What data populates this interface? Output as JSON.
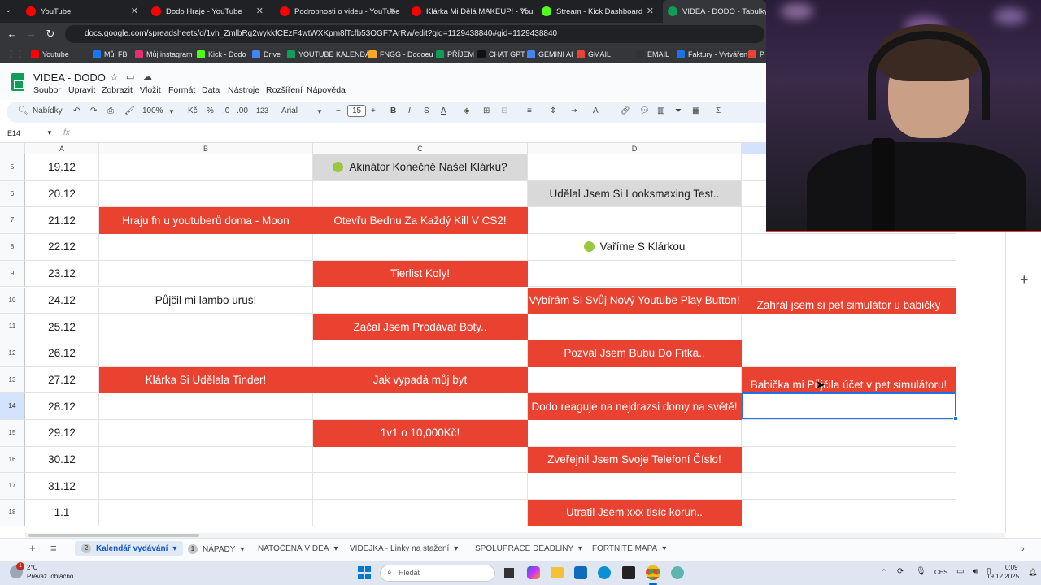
{
  "browser": {
    "tabs": [
      {
        "title": "YouTube",
        "color": "#ff0000"
      },
      {
        "title": "Dodo Hraje - YouTube",
        "color": "#ff0000"
      },
      {
        "title": "Podrobnosti o videu - YouTube",
        "color": "#ff0000"
      },
      {
        "title": "Klárka Mi Dělá MAKEUP! - YouT",
        "color": "#ff0000"
      },
      {
        "title": "Stream - Kick Dashboard",
        "color": "#53fc18"
      },
      {
        "title": "VIDEA - DODO - Tabulky Goo",
        "color": "#0f9d58"
      }
    ],
    "url": "docs.google.com/spreadsheets/d/1vh_ZmlbRg2wykkfCEzF4wtWXKpm8lTcfb53OGF7ArRw/edit?gid=1129438840#gid=1129438840",
    "bookmarks": [
      "Youtube",
      "Můj FB",
      "Můj instagram",
      "Kick - Dodo",
      "Drive",
      "YOUTUBE KALENDÁŘ",
      "FNGG - Dodoeu",
      "PŘÍJEM",
      "CHAT GPT",
      "GEMINI AI",
      "GMAIL",
      "EMAIL",
      "Faktury - Vytváření",
      "P"
    ]
  },
  "sheets": {
    "title": "VIDEA - DODO",
    "menu": [
      "Soubor",
      "Upravit",
      "Zobrazit",
      "Vložit",
      "Formát",
      "Data",
      "Nástroje",
      "Rozšíření",
      "Nápověda"
    ],
    "toolbar": {
      "search": "Nabídky",
      "zoom": "100%",
      "currency": "Kč",
      "percent": "%",
      "decimals": ".0",
      "decimals2": ".00",
      "numformat": "123",
      "font": "Arial",
      "fontsize": "15"
    },
    "cell_ref": "E14",
    "fx": "fx",
    "columns": [
      "A",
      "B",
      "C",
      "D"
    ],
    "rows": [
      {
        "num": "5",
        "date": "19.12",
        "b": "",
        "c": "Akinátor Konečně Našel Klárku?",
        "d": "",
        "e": ""
      },
      {
        "num": "6",
        "date": "20.12",
        "b": "",
        "c": "",
        "d": "Udělal Jsem Si Looksmaxing Test..",
        "e": ""
      },
      {
        "num": "7",
        "date": "21.12",
        "b": "Hraju fn u youtuberů doma - Moon",
        "c": "Otevřu Bednu Za Každý Kill V CS2!",
        "d": "",
        "e": ""
      },
      {
        "num": "8",
        "date": "22.12",
        "b": "",
        "c": "",
        "d": "Vaříme S Klárkou",
        "e": ""
      },
      {
        "num": "9",
        "date": "23.12",
        "b": "",
        "c": "Tierlist Koly!",
        "d": "",
        "e": ""
      },
      {
        "num": "10",
        "date": "24.12",
        "b": "Půjčil mi lambo urus!",
        "c": "",
        "d": "Vybírám Si Svůj Nový Youtube Play Button!",
        "e": "Zahrál jsem si pet simulátor u babičky"
      },
      {
        "num": "11",
        "date": "25.12",
        "b": "",
        "c": "Začal Jsem Prodávat Boty..",
        "d": "",
        "e": ""
      },
      {
        "num": "12",
        "date": "26.12",
        "b": "",
        "c": "",
        "d": "Pozval Jsem Bubu Do Fitka..",
        "e": ""
      },
      {
        "num": "13",
        "date": "27.12",
        "b": "Klárka Si Udělala Tinder!",
        "c": "Jak vypadá můj byt",
        "d": "",
        "e": "Babička mi Půjčila účet v pet simulátoru!"
      },
      {
        "num": "14",
        "date": "28.12",
        "b": "",
        "c": "",
        "d": "Dodo reaguje na nejdrazsi domy na světě!",
        "e": ""
      },
      {
        "num": "15",
        "date": "29.12",
        "b": "",
        "c": "1v1 o 10,000Kč!",
        "d": "",
        "e": ""
      },
      {
        "num": "16",
        "date": "30.12",
        "b": "",
        "c": "",
        "d": "Zveřejnil Jsem Svoje Telefoní Číslo!",
        "e": ""
      },
      {
        "num": "17",
        "date": "31.12",
        "b": "",
        "c": "",
        "d": "",
        "e": ""
      },
      {
        "num": "18",
        "date": "1.1",
        "b": "",
        "c": "",
        "d": "Utratil Jsem xxx tisíc korun..",
        "e": ""
      }
    ],
    "sheet_tabs": [
      {
        "badge": "2",
        "label": "Kalendář vydávání",
        "active": true
      },
      {
        "badge": "1",
        "label": "NÁPADY",
        "active": false
      },
      {
        "badge": "",
        "label": "NATOČENÁ VIDEA",
        "active": false
      },
      {
        "badge": "",
        "label": "VIDEJKA - Linky na stažení",
        "active": false
      },
      {
        "badge": "",
        "label": "SPOLUPRÁCE DEADLINY",
        "active": false
      },
      {
        "badge": "",
        "label": "FORTNITE MAPA",
        "active": false
      }
    ]
  },
  "taskbar": {
    "weather_temp": "2°C",
    "weather_desc": "Převáž. oblačno",
    "search_placeholder": "Hledat",
    "lang": "CES",
    "time": "0:09",
    "date": "19.12.2025",
    "notify": "1"
  },
  "colors": {
    "accent_red": "#ea4230",
    "selected_gray": "#d9d9d9",
    "sheets_green": "#0f9d58"
  }
}
